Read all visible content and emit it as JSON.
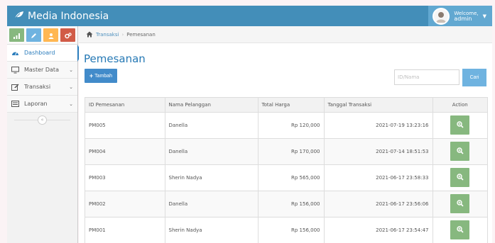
{
  "app": {
    "title": "Media Indonesia"
  },
  "user": {
    "welcome": "Welcome,",
    "name": "admin"
  },
  "breadcrumb": {
    "parent": "Transaksi",
    "current": "Pemesanan"
  },
  "sidebar": {
    "items": [
      {
        "label": "Dashboard",
        "icon": "tachometer-icon"
      },
      {
        "label": "Master Data",
        "icon": "desktop-icon"
      },
      {
        "label": "Transaksi",
        "icon": "edit-icon"
      },
      {
        "label": "Laporan",
        "icon": "list-alt-icon"
      }
    ]
  },
  "page": {
    "title": "Pemesanan",
    "add_label": "Tambah"
  },
  "search": {
    "placeholder": "ID/Nama",
    "button_label": "Cari"
  },
  "table": {
    "columns": [
      "ID Pemesanan",
      "Nama Pelanggan",
      "Total Harga",
      "Tanggal Transaksi",
      "Action"
    ],
    "rows": [
      {
        "id": "PM005",
        "name": "Danella",
        "total": "Rp 120,000",
        "date": "2021-07-19 13:23:16"
      },
      {
        "id": "PM004",
        "name": "Danella",
        "total": "Rp 170,000",
        "date": "2021-07-14 18:51:53"
      },
      {
        "id": "PM003",
        "name": "Sherin Nadya",
        "total": "Rp 565,000",
        "date": "2021-06-17 23:58:33"
      },
      {
        "id": "PM002",
        "name": "Danella",
        "total": "Rp 156,000",
        "date": "2021-06-17 23:56:06"
      },
      {
        "id": "PM001",
        "name": "Sherin Nadya",
        "total": "Rp 156,000",
        "date": "2021-06-17 23:54:47"
      }
    ]
  },
  "colors": {
    "navbar": "#438eb9",
    "accent": "#2679b5",
    "shortcut_green": "#87b87f",
    "shortcut_blue": "#6fb3e0",
    "shortcut_yellow": "#ffb752",
    "shortcut_red": "#d15b47",
    "view_button": "#87b87f"
  }
}
